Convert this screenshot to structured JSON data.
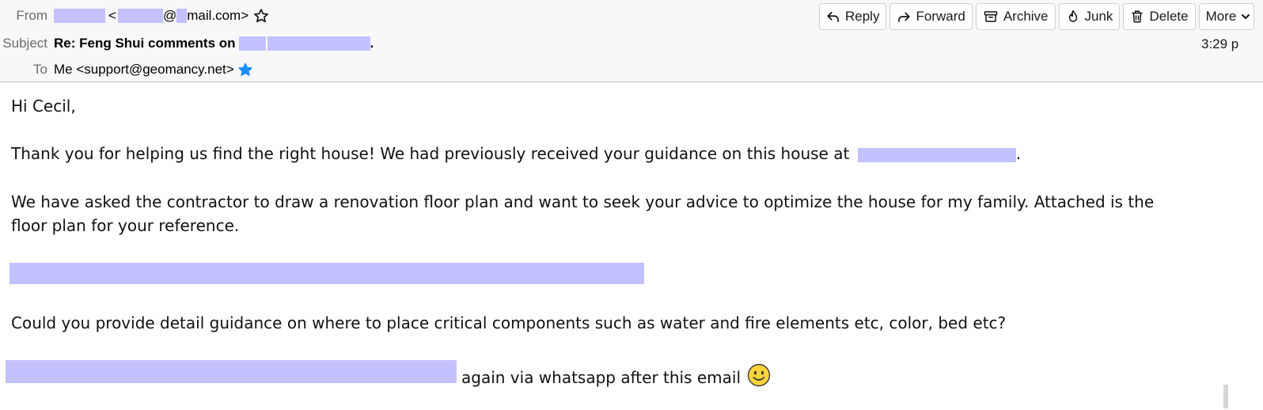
{
  "header": {
    "from_label": "From",
    "from_lt": "<",
    "from_at": "@",
    "from_domain": "mail.com>",
    "subject_label": "Subject",
    "subject_text": "Re: Feng Shui comments on",
    "subject_end": ".",
    "to_label": "To",
    "to_value": "Me <support@geomancy.net>",
    "time": "3:29 p"
  },
  "toolbar": {
    "reply": "Reply",
    "forward": "Forward",
    "archive": "Archive",
    "junk": "Junk",
    "delete": "Delete",
    "more": "More"
  },
  "message": {
    "greeting": "Hi Cecil,",
    "p1": "Thank you for helping us find the right house! We had previously received your guidance on this house at",
    "p1_end": ".",
    "p2_line1": "We have asked the contractor to draw a renovation floor plan and want to seek your advice to optimize the house for my family. Attached is the",
    "p2_line2": "floor plan for your reference.",
    "p3": "Could you provide detail guidance on where to place critical components such as water and fire elements etc, color, bed etc?",
    "p4": "again via whatsapp after this email"
  },
  "colors": {
    "redaction": "#c3c1ff",
    "star_blue": "#1a8cff",
    "header_bg": "#f8f8f9"
  }
}
